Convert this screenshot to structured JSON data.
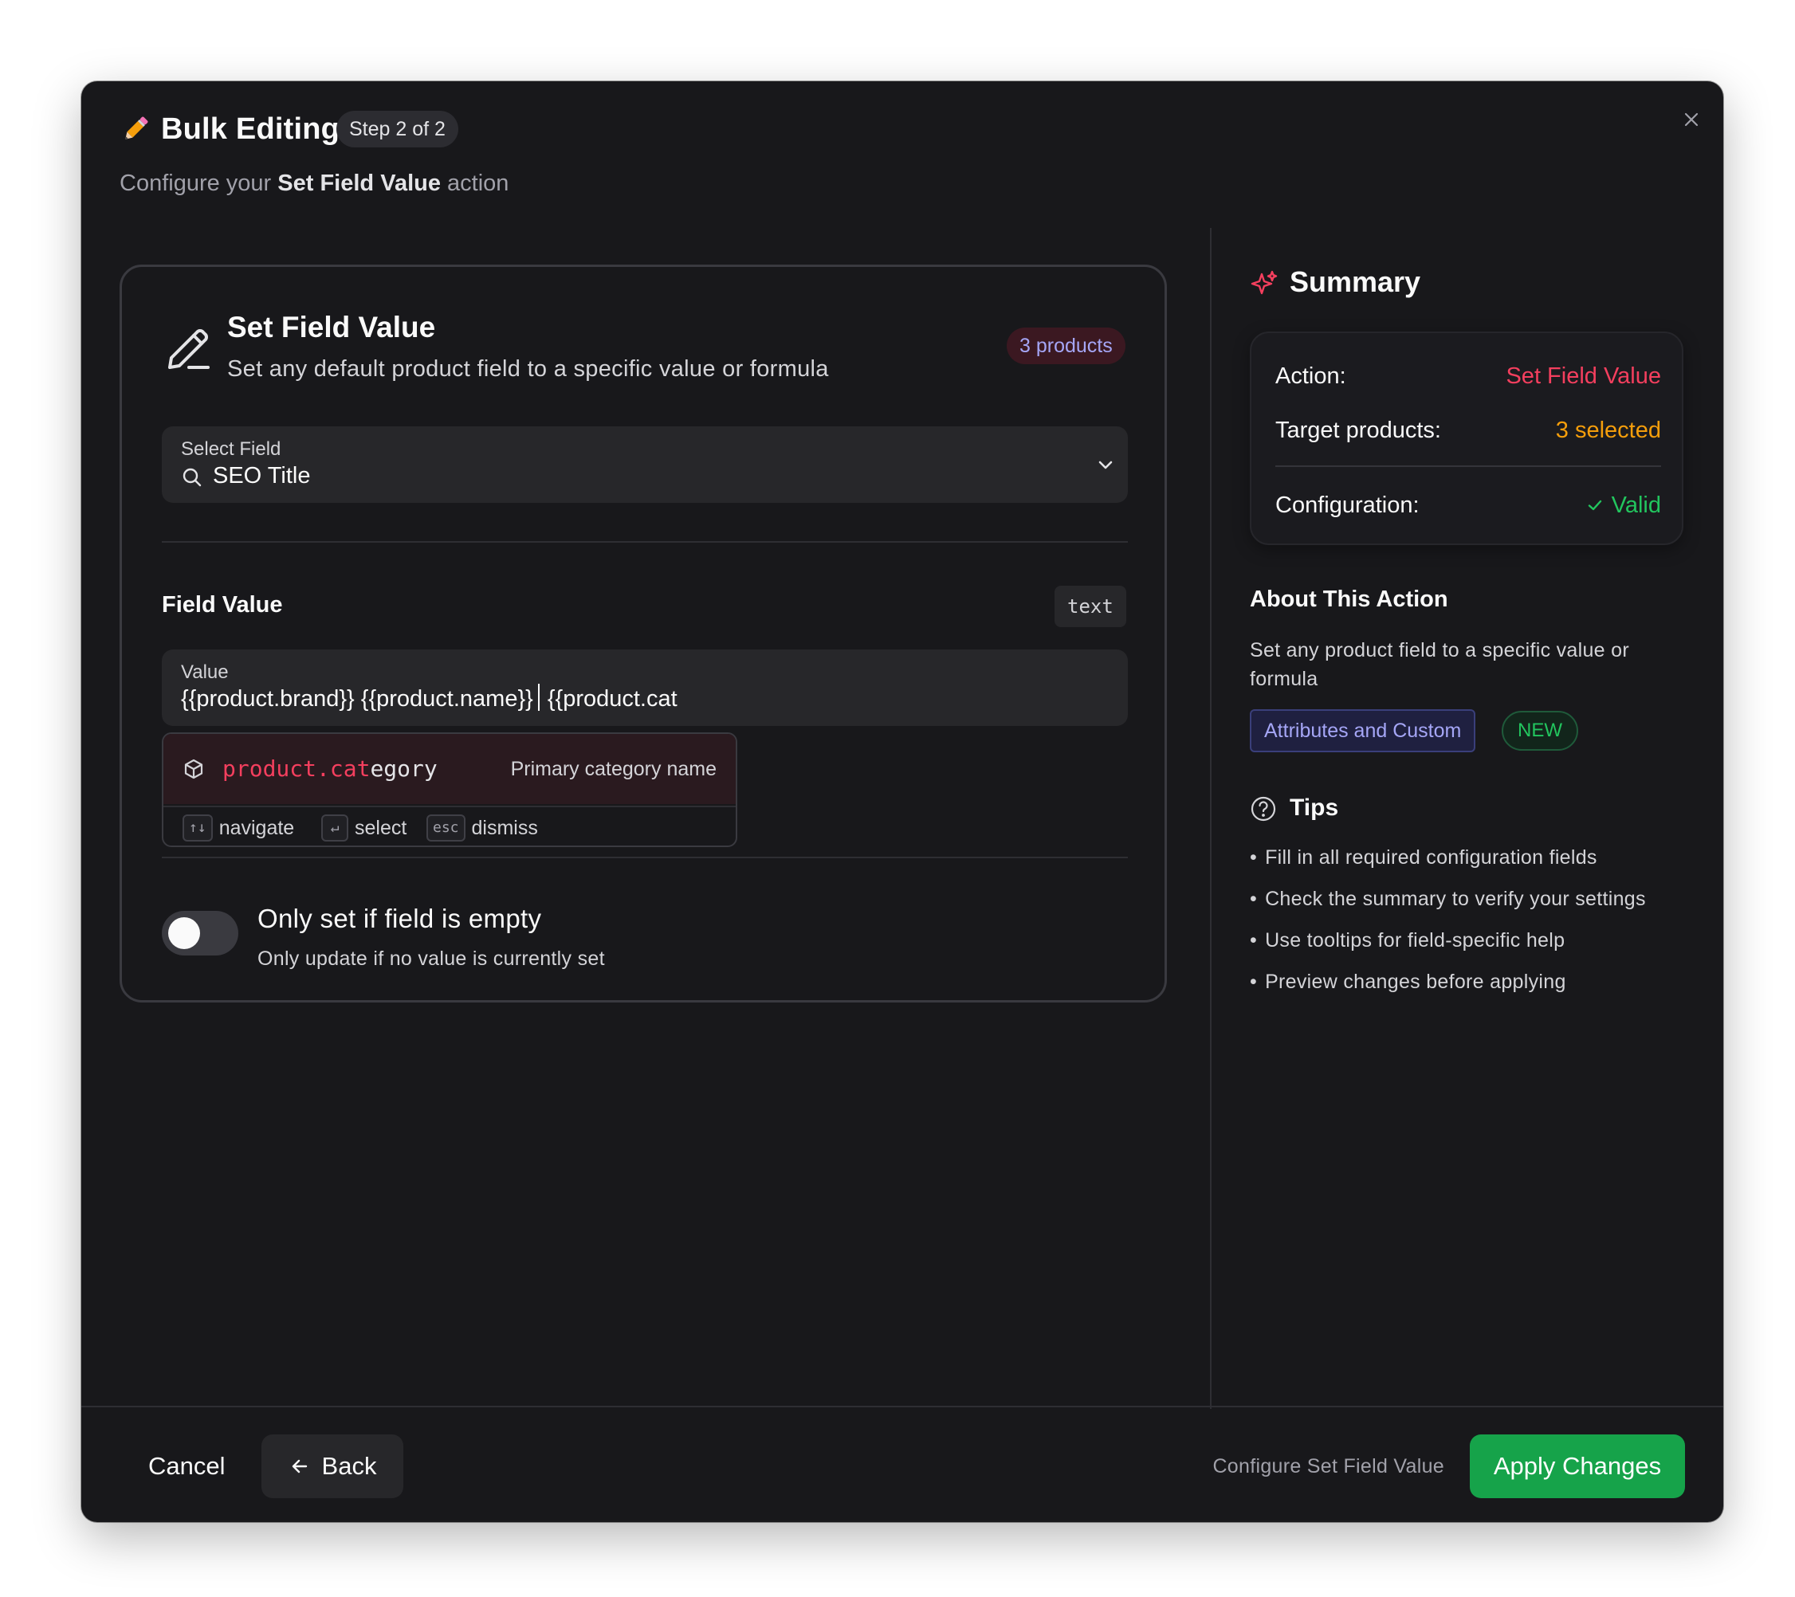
{
  "header": {
    "title": "Bulk Editing",
    "step": "Step 2 of 2",
    "subtitle_prefix": "Configure your",
    "subtitle_action": "Set Field Value",
    "subtitle_suffix": "action"
  },
  "action_card": {
    "title": "Set Field Value",
    "description": "Set any default product field to a specific value or formula",
    "products_badge": "3 products",
    "select_field": {
      "label": "Select Field",
      "value": "SEO Title"
    },
    "field_value": {
      "label": "Field Value",
      "type_badge": "text",
      "input_label": "Value",
      "input_text_before_cursor": "{{product.brand}} {{product.name}}",
      "input_text_after_cursor": "{{product.cat"
    },
    "suggestion": {
      "match": "product.cat",
      "rest": "egory",
      "description": "Primary category name",
      "hints": [
        {
          "key": "↑↓",
          "label": "navigate"
        },
        {
          "key": "↵",
          "label": "select"
        },
        {
          "key": "esc",
          "label": "dismiss"
        }
      ]
    },
    "toggle": {
      "title": "Only set if field is empty",
      "description": "Only update if no value is currently set",
      "checked": false
    }
  },
  "summary": {
    "title": "Summary",
    "rows": [
      {
        "label": "Action:",
        "value": "Set Field Value",
        "color": "#f43f5e"
      },
      {
        "label": "Target products:",
        "value": "3 selected",
        "color": "#f59e0b"
      },
      {
        "label": "Configuration:",
        "value": "Valid",
        "color": "#22c55e"
      }
    ]
  },
  "about": {
    "title": "About This Action",
    "description": "Set any product field to a specific value or formula",
    "tag": "Attributes and Custom",
    "new_badge": "NEW"
  },
  "tips": {
    "title": "Tips",
    "items": [
      "Fill in all required configuration fields",
      "Check the summary to verify your settings",
      "Use tooltips for field-specific help",
      "Preview changes before applying"
    ]
  },
  "footer": {
    "cancel": "Cancel",
    "back": "Back",
    "hint": "Configure Set Field Value",
    "apply": "Apply Changes"
  },
  "colors": {
    "accent_red": "#f43f5e",
    "accent_green": "#16a34a",
    "accent_amber": "#f59e0b",
    "accent_indigo": "#a5a6f6",
    "modal_bg": "#18181b"
  },
  "icons": {
    "header": "pencil-emoji-icon",
    "close": "close-icon",
    "card": "pen-icon",
    "select_search": "search-icon",
    "select_chevron": "chevron-down-icon",
    "suggestion": "cube-icon",
    "summary": "sparkles-icon",
    "valid": "check-icon",
    "tips": "help-circle-icon",
    "back": "arrow-left-icon"
  }
}
